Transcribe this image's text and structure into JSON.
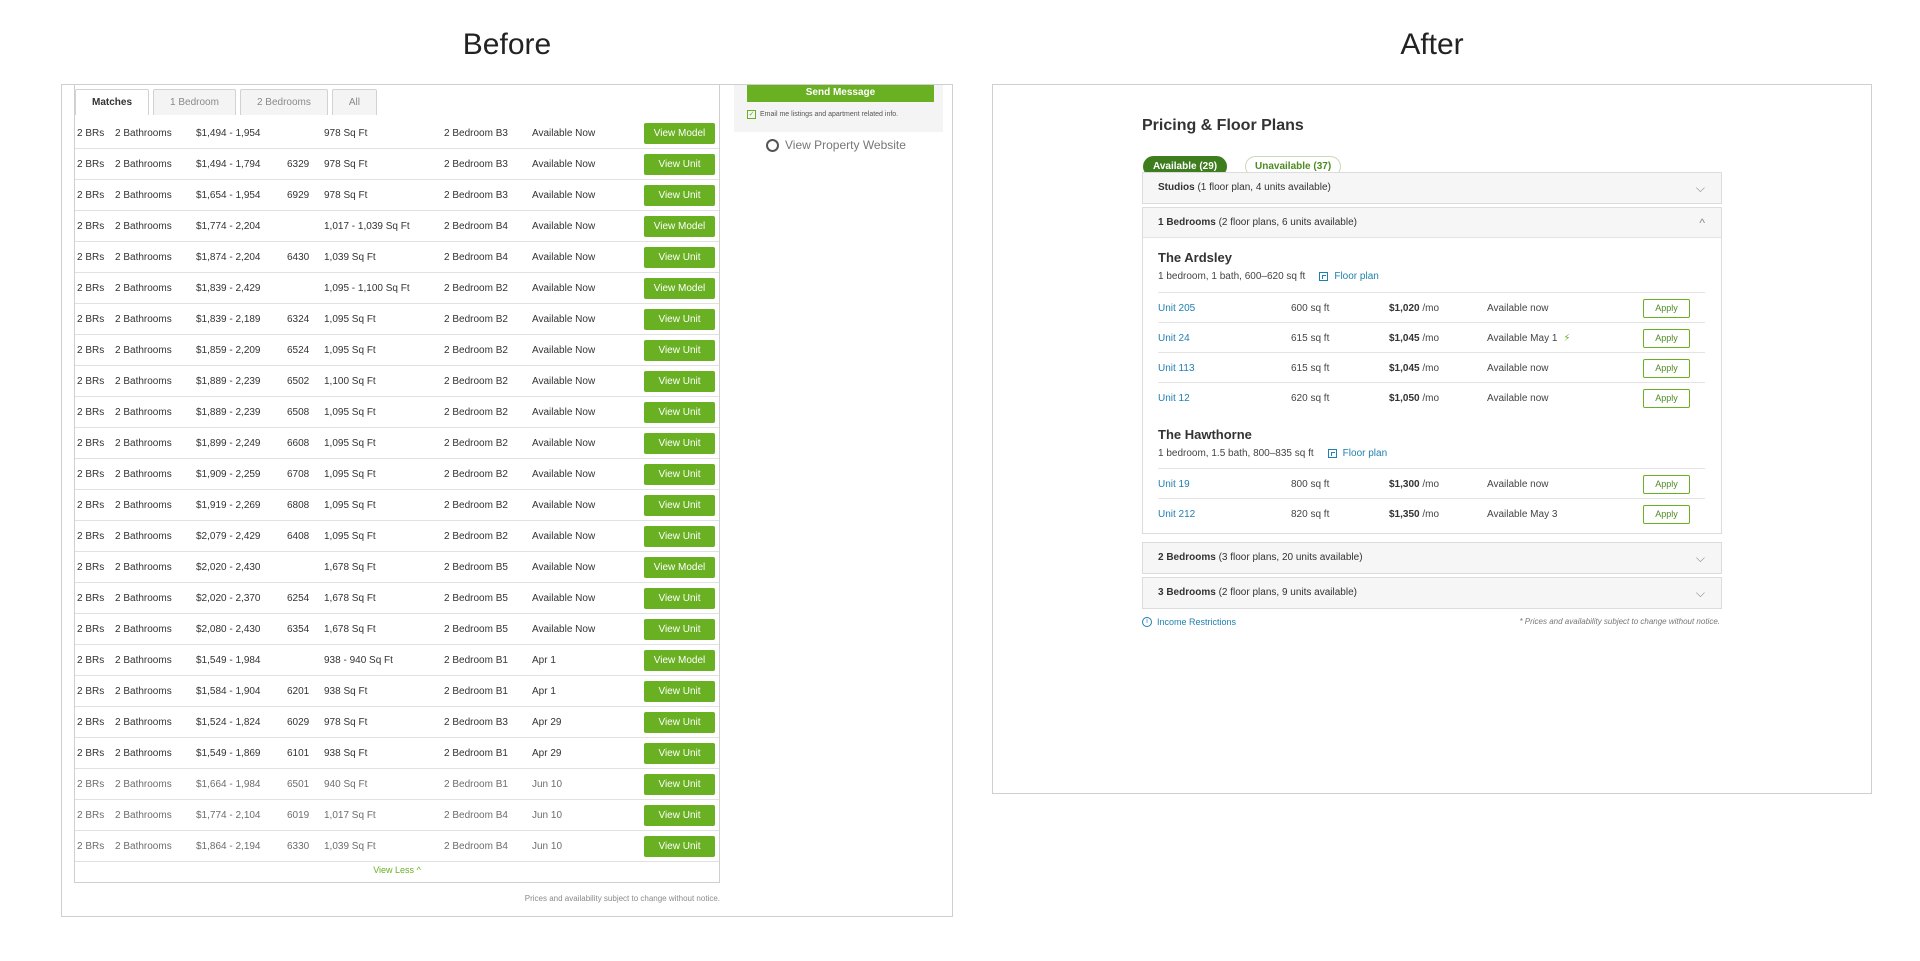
{
  "headings": {
    "before": "Before",
    "after": "After"
  },
  "before": {
    "tabs": [
      "Matches",
      "1 Bedroom",
      "2 Bedrooms",
      "All"
    ],
    "rows": [
      {
        "beds": "2 BRs",
        "baths": "2 Bathrooms",
        "price": "$1,494 - 1,954",
        "unit": "",
        "sqft": "978 Sq Ft",
        "plan": "2 Bedroom B3",
        "avail": "Available Now",
        "btn": "View Model",
        "past": false
      },
      {
        "beds": "2 BRs",
        "baths": "2 Bathrooms",
        "price": "$1,494 - 1,794",
        "unit": "6329",
        "sqft": "978 Sq Ft",
        "plan": "2 Bedroom B3",
        "avail": "Available Now",
        "btn": "View Unit",
        "past": false
      },
      {
        "beds": "2 BRs",
        "baths": "2 Bathrooms",
        "price": "$1,654 - 1,954",
        "unit": "6929",
        "sqft": "978 Sq Ft",
        "plan": "2 Bedroom B3",
        "avail": "Available Now",
        "btn": "View Unit",
        "past": false
      },
      {
        "beds": "2 BRs",
        "baths": "2 Bathrooms",
        "price": "$1,774 - 2,204",
        "unit": "",
        "sqft": "1,017 - 1,039 Sq Ft",
        "plan": "2 Bedroom B4",
        "avail": "Available Now",
        "btn": "View Model",
        "past": false
      },
      {
        "beds": "2 BRs",
        "baths": "2 Bathrooms",
        "price": "$1,874 - 2,204",
        "unit": "6430",
        "sqft": "1,039 Sq Ft",
        "plan": "2 Bedroom B4",
        "avail": "Available Now",
        "btn": "View Unit",
        "past": false
      },
      {
        "beds": "2 BRs",
        "baths": "2 Bathrooms",
        "price": "$1,839 - 2,429",
        "unit": "",
        "sqft": "1,095 - 1,100 Sq Ft",
        "plan": "2 Bedroom B2",
        "avail": "Available Now",
        "btn": "View Model",
        "past": false
      },
      {
        "beds": "2 BRs",
        "baths": "2 Bathrooms",
        "price": "$1,839 - 2,189",
        "unit": "6324",
        "sqft": "1,095 Sq Ft",
        "plan": "2 Bedroom B2",
        "avail": "Available Now",
        "btn": "View Unit",
        "past": false
      },
      {
        "beds": "2 BRs",
        "baths": "2 Bathrooms",
        "price": "$1,859 - 2,209",
        "unit": "6524",
        "sqft": "1,095 Sq Ft",
        "plan": "2 Bedroom B2",
        "avail": "Available Now",
        "btn": "View Unit",
        "past": false
      },
      {
        "beds": "2 BRs",
        "baths": "2 Bathrooms",
        "price": "$1,889 - 2,239",
        "unit": "6502",
        "sqft": "1,100 Sq Ft",
        "plan": "2 Bedroom B2",
        "avail": "Available Now",
        "btn": "View Unit",
        "past": false
      },
      {
        "beds": "2 BRs",
        "baths": "2 Bathrooms",
        "price": "$1,889 - 2,239",
        "unit": "6508",
        "sqft": "1,095 Sq Ft",
        "plan": "2 Bedroom B2",
        "avail": "Available Now",
        "btn": "View Unit",
        "past": false
      },
      {
        "beds": "2 BRs",
        "baths": "2 Bathrooms",
        "price": "$1,899 - 2,249",
        "unit": "6608",
        "sqft": "1,095 Sq Ft",
        "plan": "2 Bedroom B2",
        "avail": "Available Now",
        "btn": "View Unit",
        "past": false
      },
      {
        "beds": "2 BRs",
        "baths": "2 Bathrooms",
        "price": "$1,909 - 2,259",
        "unit": "6708",
        "sqft": "1,095 Sq Ft",
        "plan": "2 Bedroom B2",
        "avail": "Available Now",
        "btn": "View Unit",
        "past": false
      },
      {
        "beds": "2 BRs",
        "baths": "2 Bathrooms",
        "price": "$1,919 - 2,269",
        "unit": "6808",
        "sqft": "1,095 Sq Ft",
        "plan": "2 Bedroom B2",
        "avail": "Available Now",
        "btn": "View Unit",
        "past": false
      },
      {
        "beds": "2 BRs",
        "baths": "2 Bathrooms",
        "price": "$2,079 - 2,429",
        "unit": "6408",
        "sqft": "1,095 Sq Ft",
        "plan": "2 Bedroom B2",
        "avail": "Available Now",
        "btn": "View Unit",
        "past": false
      },
      {
        "beds": "2 BRs",
        "baths": "2 Bathrooms",
        "price": "$2,020 - 2,430",
        "unit": "",
        "sqft": "1,678 Sq Ft",
        "plan": "2 Bedroom B5",
        "avail": "Available Now",
        "btn": "View Model",
        "past": false
      },
      {
        "beds": "2 BRs",
        "baths": "2 Bathrooms",
        "price": "$2,020 - 2,370",
        "unit": "6254",
        "sqft": "1,678 Sq Ft",
        "plan": "2 Bedroom B5",
        "avail": "Available Now",
        "btn": "View Unit",
        "past": false
      },
      {
        "beds": "2 BRs",
        "baths": "2 Bathrooms",
        "price": "$2,080 - 2,430",
        "unit": "6354",
        "sqft": "1,678 Sq Ft",
        "plan": "2 Bedroom B5",
        "avail": "Available Now",
        "btn": "View Unit",
        "past": false
      },
      {
        "beds": "2 BRs",
        "baths": "2 Bathrooms",
        "price": "$1,549 - 1,984",
        "unit": "",
        "sqft": "938 - 940 Sq Ft",
        "plan": "2 Bedroom B1",
        "avail": "Apr 1",
        "btn": "View Model",
        "past": false
      },
      {
        "beds": "2 BRs",
        "baths": "2 Bathrooms",
        "price": "$1,584 - 1,904",
        "unit": "6201",
        "sqft": "938 Sq Ft",
        "plan": "2 Bedroom B1",
        "avail": "Apr 1",
        "btn": "View Unit",
        "past": false
      },
      {
        "beds": "2 BRs",
        "baths": "2 Bathrooms",
        "price": "$1,524 - 1,824",
        "unit": "6029",
        "sqft": "978 Sq Ft",
        "plan": "2 Bedroom B3",
        "avail": "Apr 29",
        "btn": "View Unit",
        "past": false
      },
      {
        "beds": "2 BRs",
        "baths": "2 Bathrooms",
        "price": "$1,549 - 1,869",
        "unit": "6101",
        "sqft": "938 Sq Ft",
        "plan": "2 Bedroom B1",
        "avail": "Apr 29",
        "btn": "View Unit",
        "past": false
      },
      {
        "beds": "2 BRs",
        "baths": "2 Bathrooms",
        "price": "$1,664 - 1,984",
        "unit": "6501",
        "sqft": "940 Sq Ft",
        "plan": "2 Bedroom B1",
        "avail": "Jun 10",
        "btn": "View Unit",
        "past": true
      },
      {
        "beds": "2 BRs",
        "baths": "2 Bathrooms",
        "price": "$1,774 - 2,104",
        "unit": "6019",
        "sqft": "1,017 Sq Ft",
        "plan": "2 Bedroom B4",
        "avail": "Jun 10",
        "btn": "View Unit",
        "past": true
      },
      {
        "beds": "2 BRs",
        "baths": "2 Bathrooms",
        "price": "$1,864 - 2,194",
        "unit": "6330",
        "sqft": "1,039 Sq Ft",
        "plan": "2 Bedroom B4",
        "avail": "Jun 10",
        "btn": "View Unit",
        "past": true
      }
    ],
    "view_less": "View Less",
    "disclaimer": "Prices and availability subject to change without notice.",
    "send_message": "Send Message",
    "email_opt": "Email me listings and apartment related info.",
    "property_link": "View Property Website"
  },
  "after": {
    "title": "Pricing & Floor Plans",
    "pill_available": "Available (29)",
    "pill_unavailable": "Unavailable (37)",
    "sections": {
      "studios": {
        "name": "Studios",
        "detail": "(1 floor plan, 4 units available)"
      },
      "one_bed": {
        "name": "1 Bedrooms",
        "detail": "(2 floor plans, 6 units available)"
      },
      "two_bed": {
        "name": "2 Bedrooms",
        "detail": "(3 floor plans, 20 units available)"
      },
      "three_bed": {
        "name": "3 Bedrooms",
        "detail": "(2 floor plans, 9 units available)"
      }
    },
    "floorplans": [
      {
        "name": "The Ardsley",
        "info": "1 bedroom, 1 bath, 600–620 sq ft",
        "link": "Floor plan",
        "units": [
          {
            "unit": "Unit 205",
            "sqft": "600 sq ft",
            "rent": "$1,020",
            "per": "/mo",
            "avail": "Available now",
            "bolt": false,
            "apply": "Apply"
          },
          {
            "unit": "Unit 24",
            "sqft": "615 sq ft",
            "rent": "$1,045",
            "per": "/mo",
            "avail": "Available May 1",
            "bolt": true,
            "apply": "Apply"
          },
          {
            "unit": "Unit 113",
            "sqft": "615 sq ft",
            "rent": "$1,045",
            "per": "/mo",
            "avail": "Available now",
            "bolt": false,
            "apply": "Apply"
          },
          {
            "unit": "Unit 12",
            "sqft": "620 sq ft",
            "rent": "$1,050",
            "per": "/mo",
            "avail": "Available now",
            "bolt": false,
            "apply": "Apply"
          }
        ]
      },
      {
        "name": "The Hawthorne",
        "info": "1 bedroom, 1.5 bath, 800–835 sq ft",
        "link": "Floor plan",
        "units": [
          {
            "unit": "Unit 19",
            "sqft": "800 sq ft",
            "rent": "$1,300",
            "per": "/mo",
            "avail": "Available now",
            "bolt": false,
            "apply": "Apply"
          },
          {
            "unit": "Unit 212",
            "sqft": "820 sq ft",
            "rent": "$1,350",
            "per": "/mo",
            "avail": "Available May 3",
            "bolt": false,
            "apply": "Apply"
          }
        ]
      }
    ],
    "income_link": "Income Restrictions",
    "disclaimer": "* Prices and availability subject to change without notice."
  }
}
